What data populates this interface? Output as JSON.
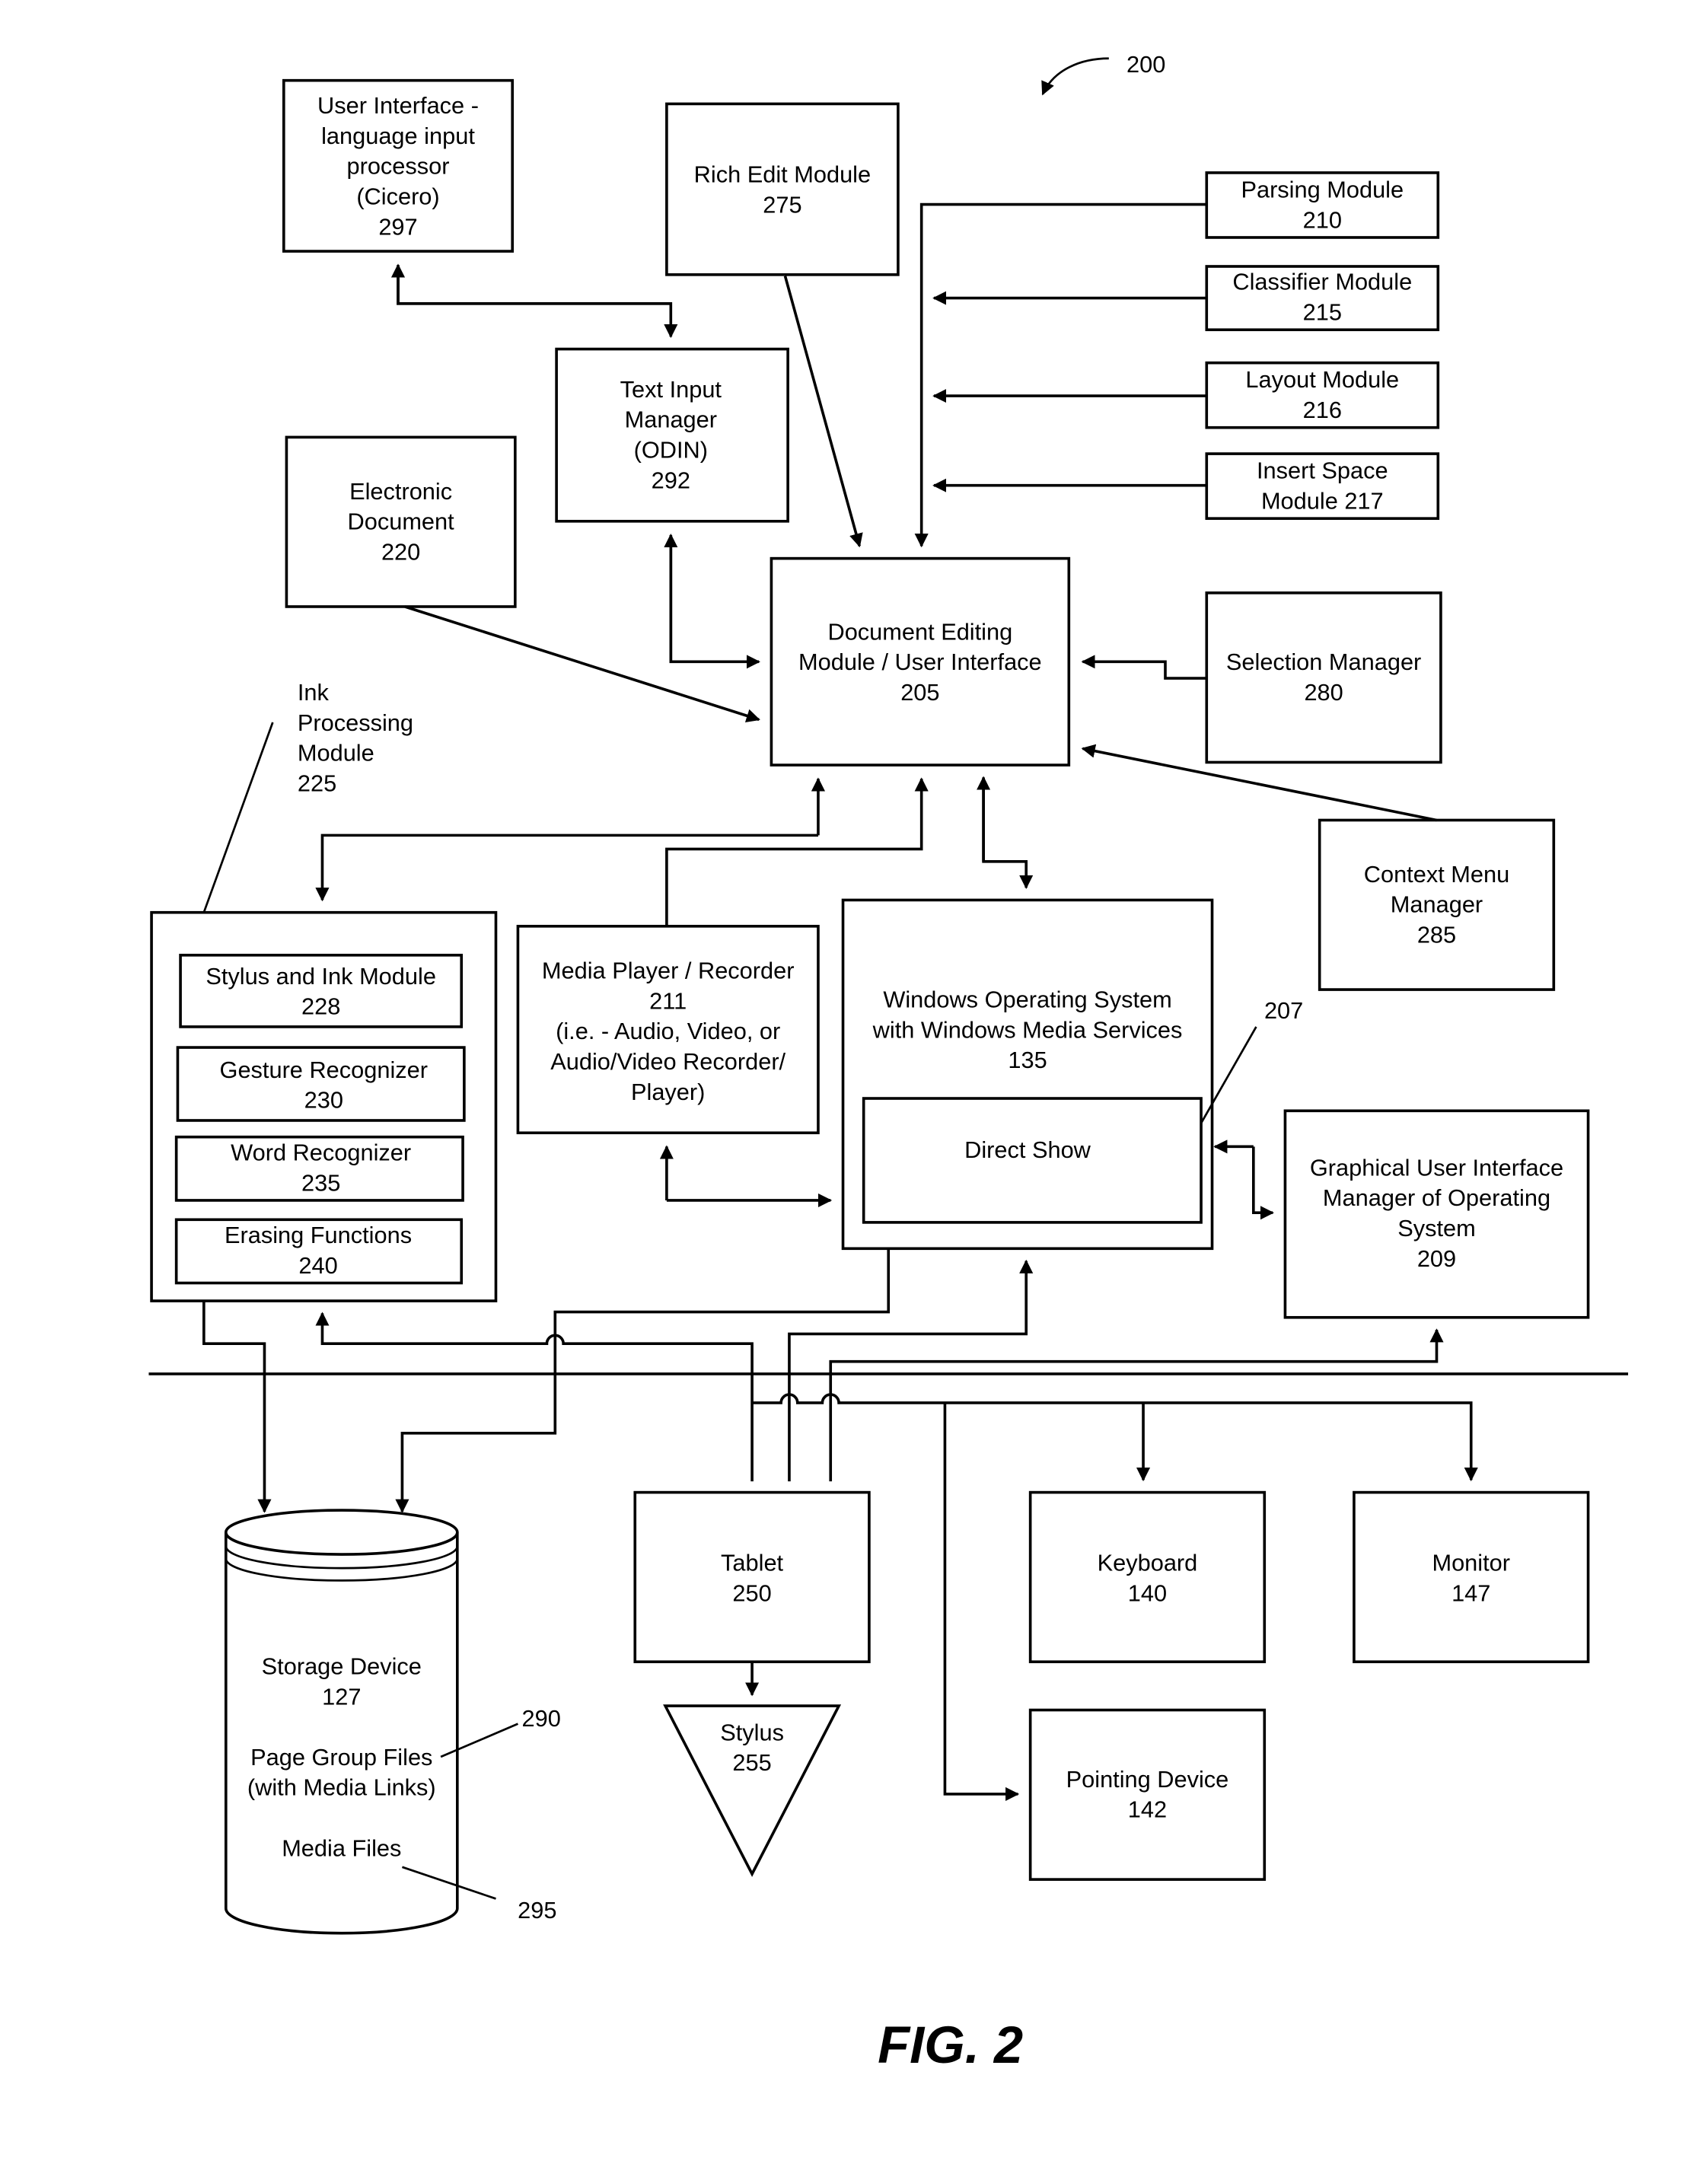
{
  "figure": {
    "ref": "200",
    "caption": "FIG. 2"
  },
  "blocks": {
    "cicero": [
      "User Interface -",
      "language input",
      "processor",
      "(Cicero)",
      "297"
    ],
    "rich_edit": [
      "Rich Edit Module",
      "275"
    ],
    "parsing": [
      "Parsing Module",
      "210"
    ],
    "classifier": [
      "Classifier Module",
      "215"
    ],
    "layout": [
      "Layout Module",
      "216"
    ],
    "insert_space": [
      "Insert Space",
      "Module  217"
    ],
    "text_input": [
      "Text Input",
      "Manager",
      "(ODIN)",
      "292"
    ],
    "electronic_doc": [
      "Electronic",
      "Document",
      "220"
    ],
    "doc_editing": [
      "Document Editing",
      "Module / User Interface",
      "205"
    ],
    "selection": [
      "Selection Manager",
      "280"
    ],
    "ink_label": [
      "Ink",
      "Processing",
      "Module",
      "225"
    ],
    "context_menu": [
      "Context Menu",
      "Manager",
      "285"
    ],
    "stylus_ink": [
      "Stylus and Ink Module",
      "228"
    ],
    "gesture": [
      "Gesture Recognizer",
      "230"
    ],
    "word": [
      "Word Recognizer",
      "235"
    ],
    "erasing": [
      "Erasing Functions",
      "240"
    ],
    "media_player": [
      "Media Player / Recorder",
      "211",
      "(i.e. - Audio, Video, or",
      "Audio/Video Recorder/",
      "Player)"
    ],
    "windows_os": [
      "Windows Operating System",
      "with Windows Media Services",
      "135"
    ],
    "direct_show": [
      "Direct Show"
    ],
    "direct_show_ref": "207",
    "gui_manager": [
      "Graphical User Interface",
      "Manager of Operating",
      "System",
      "209"
    ],
    "storage": [
      "Storage Device",
      "127"
    ],
    "page_group": [
      "Page Group Files",
      "(with Media Links)"
    ],
    "page_group_ref": "290",
    "media_files": [
      "Media Files"
    ],
    "media_files_ref": "295",
    "tablet": [
      "Tablet",
      "250"
    ],
    "stylus": [
      "Stylus",
      "255"
    ],
    "keyboard": [
      "Keyboard",
      "140"
    ],
    "monitor": [
      "Monitor",
      "147"
    ],
    "pointing": [
      "Pointing Device",
      "142"
    ]
  }
}
